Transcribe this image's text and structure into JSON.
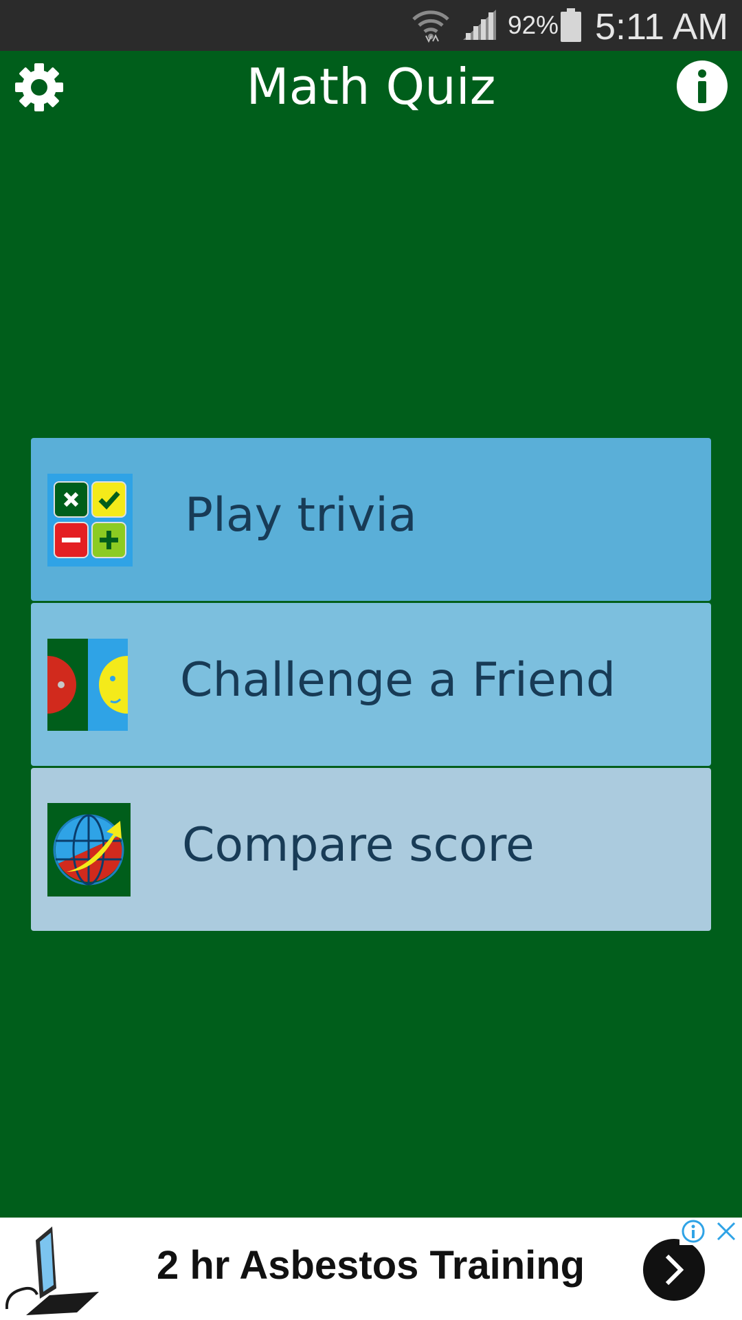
{
  "status_bar": {
    "battery_percent": "92%",
    "time": "5:11 AM",
    "icons": [
      "wifi-icon",
      "signal-icon",
      "battery-icon"
    ]
  },
  "header": {
    "title": "Math Quiz",
    "left_icon": "gear-icon",
    "right_icon": "info-icon"
  },
  "menu": {
    "items": [
      {
        "label": "Play trivia",
        "icon": "calculator-icon",
        "color": "#5aafd8"
      },
      {
        "label": "Challenge a Friend",
        "icon": "faces-icon",
        "color": "#7cbfde"
      },
      {
        "label": "Compare score",
        "icon": "globe-icon",
        "color": "#abcbde"
      }
    ]
  },
  "ad": {
    "text": "2 hr Asbestos Training",
    "icons": [
      "computer-logo-icon",
      "ad-choices-icon",
      "close-icon",
      "arrow-right-icon"
    ]
  },
  "colors": {
    "background": "#005e1b",
    "status_bar": "#2b2b2b",
    "label_text": "#183b56"
  }
}
